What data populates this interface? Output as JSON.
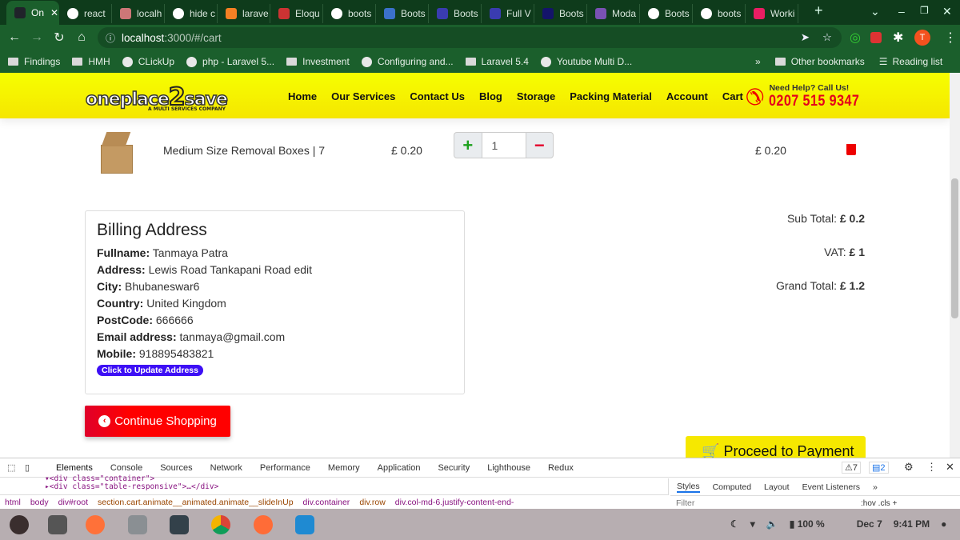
{
  "browser": {
    "tabs": [
      {
        "label": "On",
        "color": "#20232a"
      },
      {
        "label": "react",
        "color": "#fff"
      },
      {
        "label": "localh",
        "color": "#c77"
      },
      {
        "label": "hide c",
        "color": "#fff"
      },
      {
        "label": "larave",
        "color": "#f48024"
      },
      {
        "label": "Eloqu",
        "color": "#c33"
      },
      {
        "label": "boots",
        "color": "#fff"
      },
      {
        "label": "Boots",
        "color": "#3b71ca"
      },
      {
        "label": "Boots",
        "color": "#3a3cb0"
      },
      {
        "label": "Full V",
        "color": "#3a3cb0"
      },
      {
        "label": "Boots",
        "color": "#14146a"
      },
      {
        "label": "Moda",
        "color": "#7952b3"
      },
      {
        "label": "Boots",
        "color": "#fff"
      },
      {
        "label": "boots",
        "color": "#fff"
      },
      {
        "label": "Worki",
        "color": "#e91e63"
      }
    ],
    "url_host": "localhost",
    "url_path": ":3000/#/cart",
    "profile_initial": "T",
    "bookmarks": [
      "Findings",
      "HMH",
      "CLickUp",
      "php - Laravel 5...",
      "Investment",
      "Configuring and...",
      "Laravel 5.4",
      "Youtube Multi D..."
    ],
    "other_bookmarks": "Other bookmarks",
    "reading_list": "Reading list"
  },
  "site": {
    "logo": {
      "main": "oneplace",
      "two": "2",
      "end": "save",
      "tagline": "A MULTI SERVICES COMPANY"
    },
    "nav": [
      "Home",
      "Our Services",
      "Contact Us",
      "Blog",
      "Storage",
      "Packing Material",
      "Account",
      "Cart"
    ],
    "help_label": "Need Help? Call Us!",
    "phone": "0207 515 9347",
    "brand_colors": {
      "yellow": "#f5f000",
      "red": "#e4001b"
    }
  },
  "cart": {
    "item": {
      "name": "Medium Size Removal Boxes | 7",
      "price": "£ 0.20",
      "quantity": "1",
      "total": "£ 0.20"
    },
    "billing": {
      "title": "Billing Address",
      "fields": [
        {
          "label": "Fullname:",
          "value": "Tanmaya Patra"
        },
        {
          "label": "Address:",
          "value": "Lewis Road Tankapani Road edit"
        },
        {
          "label": "City:",
          "value": "Bhubaneswar6"
        },
        {
          "label": "Country:",
          "value": "United Kingdom"
        },
        {
          "label": "PostCode:",
          "value": "666666"
        },
        {
          "label": "Email address:",
          "value": "tanmaya@gmail.com"
        },
        {
          "label": "Mobile:",
          "value": "918895483821"
        }
      ],
      "update_label": "Click to Update Address"
    },
    "continue_label": "Continue Shopping",
    "sub_total_label": "Sub Total:",
    "sub_total": "£ 0.2",
    "vat_label": "VAT:",
    "vat": "£ 1",
    "grand_total_label": "Grand Total:",
    "grand_total": "£ 1.2",
    "proceed_label": "Proceed to Payment"
  },
  "devtools": {
    "tabs": [
      "Elements",
      "Console",
      "Sources",
      "Network",
      "Performance",
      "Memory",
      "Application",
      "Security",
      "Lighthouse",
      "Redux"
    ],
    "warnings": "7",
    "messages": "2",
    "code_line1": "▾<div class=\"container\">",
    "code_line2": "▸<div class=\"table-responsive\">…</div>",
    "breadcrumbs": [
      "html",
      "body",
      "div#root",
      "section.cart.animate__animated.animate__slideInUp",
      "div.container",
      "div.row",
      "div.col-md-6.justify-content-end-"
    ],
    "style_tabs": [
      "Styles",
      "Computed",
      "Layout",
      "Event Listeners",
      "»"
    ],
    "filter_placeholder": "Filter",
    "filter_tools": ":hov .cls +"
  },
  "taskbar": {
    "battery": "100 %",
    "date": "Dec 7",
    "time": "9:41 PM"
  }
}
